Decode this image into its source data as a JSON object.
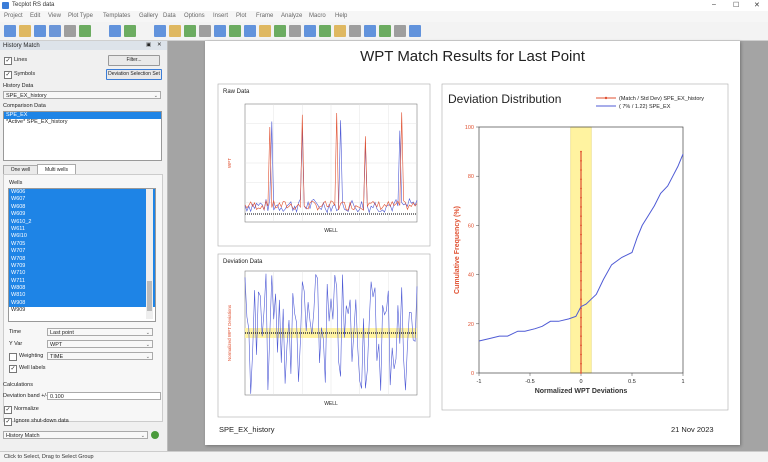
{
  "window": {
    "title": "Tecplot RS data"
  },
  "menu": [
    "Project",
    "Edit",
    "View",
    "Plot Type",
    "Templates",
    "Gallery",
    "Data",
    "Options",
    "Insert",
    "Plot",
    "Frame",
    "Analyze",
    "Macro",
    "Help"
  ],
  "panel": {
    "title": "History Match",
    "lines_label": "Lines",
    "symbols_label": "Symbols",
    "filter_label": "Filter...",
    "deviation_sel_label": "Deviation Selection Set",
    "history_data_label": "History Data",
    "history_data_value": "SPE_EX_history",
    "comparison_label": "Comparison Data",
    "comparison_items": [
      "SPE_EX",
      "*Active* SPE_EX_history"
    ],
    "tabs": [
      "One well",
      "Multi wells"
    ],
    "wells_label": "Wells",
    "wells": [
      "W606",
      "W607",
      "W608",
      "W609",
      "W610_2",
      "W611",
      "W6I10",
      "W705",
      "W707",
      "W708",
      "W709",
      "W710",
      "W711",
      "W808",
      "W810",
      "W908"
    ],
    "wells_partial": "W909",
    "time_label": "Time",
    "time_value": "Last point",
    "yvar_label": "Y Var",
    "yvar_value": "WPT",
    "weighting_label": "Weighting",
    "weighting_value": "TIME",
    "well_labels_label": "Well labels",
    "calc_label": "Calculations",
    "dev_band_label": "Deviation band +/-",
    "dev_band_value": "0.100",
    "normalize_label": "Normalize",
    "ignore_label": "Ignore shut-down data",
    "bottom_dd": "History Match"
  },
  "status": "Click to Select, Drag to Select Group",
  "page": {
    "title": "WPT Match Results for Last Point",
    "footer_left": "SPE_EX_history",
    "footer_right": "21 Nov 2023"
  },
  "charts": {
    "raw": {
      "title": "Raw Data",
      "xlabel": "WELL",
      "ylabel": "WPT"
    },
    "dev": {
      "title": "Deviation Data",
      "xlabel": "WELL",
      "ylabel": "Normalized WPT Deviations"
    },
    "dist": {
      "title": "Deviation Distribution",
      "xlabel": "Normalized WPT Deviations",
      "ylabel": "Cumulative Frequency (%)",
      "legend": [
        "(Match / Std Dev) SPE_EX_history",
        "( 7% / 1.22) SPE_EX"
      ]
    }
  },
  "chart_data": [
    {
      "type": "line",
      "title": "Deviation Distribution",
      "xlabel": "Normalized WPT Deviations",
      "ylabel": "Cumulative Frequency (%)",
      "xlim": [
        -1,
        1
      ],
      "ylim": [
        0,
        100
      ],
      "xticks": [
        "-1",
        "-0.5",
        "0",
        "0.5",
        "1"
      ],
      "yticks": [
        "0",
        "20",
        "40",
        "60",
        "80",
        "100"
      ],
      "band": [
        -0.1,
        0.1
      ],
      "series": [
        {
          "name": "(Match / Std Dev) SPE_EX_history",
          "color": "#e05030",
          "x": [
            0,
            0
          ],
          "y": [
            0,
            90
          ]
        },
        {
          "name": "( 7% / 1.22) SPE_EX",
          "color": "#4f5bd5",
          "x": [
            -1,
            -0.9,
            -0.8,
            -0.72,
            -0.62,
            -0.55,
            -0.45,
            -0.38,
            -0.3,
            -0.22,
            -0.12,
            -0.05,
            0.0,
            0.05,
            0.1,
            0.15,
            0.22,
            0.3,
            0.4,
            0.5,
            0.55,
            0.6,
            0.66,
            0.72,
            0.78,
            0.85,
            0.9,
            0.95,
            1.0
          ],
          "y": [
            13,
            14,
            15,
            15,
            17,
            17,
            18,
            19,
            21,
            21,
            22,
            23,
            27,
            28,
            30,
            32,
            38,
            44,
            47,
            49,
            55,
            60,
            64,
            68,
            73,
            76,
            80,
            84,
            89
          ]
        }
      ]
    }
  ],
  "colors": {
    "accent": "#1e84e6",
    "red": "#e05030",
    "blue": "#4f5bd5",
    "band": "#fff3a0"
  }
}
